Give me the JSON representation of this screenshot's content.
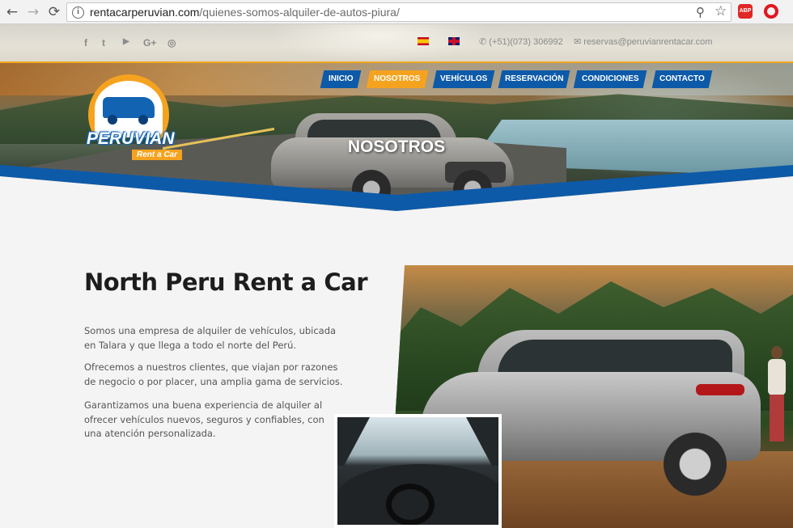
{
  "browser": {
    "url_domain": "rentacarperuvian.com",
    "url_path": "/quienes-somos-alquiler-de-autos-piura/",
    "back": "←",
    "forward": "→",
    "reload": "⟳",
    "info": "i",
    "zoom": "⚲",
    "star": "☆",
    "abp": "ABP"
  },
  "topbar": {
    "social": [
      "f",
      "t",
      "▶",
      "G+",
      "◎"
    ],
    "phone": "(+51)(073) 306992",
    "email": "reservas@peruvianrentacar.com",
    "phone_icon": "✆",
    "email_icon": "✉"
  },
  "logo": {
    "name": "PERUVIAN",
    "sub": "Rent a Car"
  },
  "menu": {
    "items": [
      {
        "label": "INICIO"
      },
      {
        "label": "NOSOTROS"
      },
      {
        "label": "VEHÍCULOS"
      },
      {
        "label": "RESERVACIÓN"
      },
      {
        "label": "CONDICIONES"
      },
      {
        "label": "CONTACTO"
      }
    ],
    "active_color": "#f5a31f",
    "color": "#0d5aa9"
  },
  "hero": {
    "title": "NOSOTROS"
  },
  "content": {
    "title": "North Peru Rent a Car",
    "paragraphs": [
      "Somos una empresa de alquiler de vehículos, ubicada en Talara y que llega a todo el norte del Perú.",
      "Ofrecemos a nuestros clientes, que viajan por razones de negocio o por placer, una amplia gama de servicios.",
      "Garantizamos una buena experiencia de alquiler al ofrecer vehículos nuevos, seguros y confiables, con una atención personalizada."
    ]
  },
  "colors": {
    "brand_blue": "#0d5aa9",
    "brand_orange": "#f5a31f"
  }
}
